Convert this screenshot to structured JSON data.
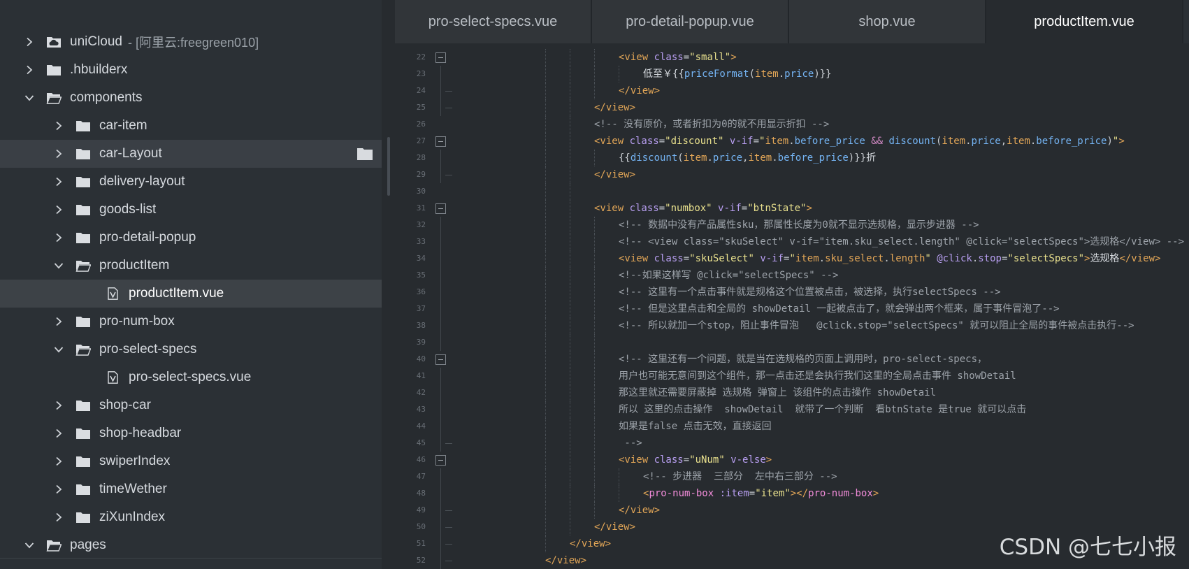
{
  "sidebar": {
    "items": [
      {
        "label": "uniCloud",
        "suffix": "- [阿里云:freegreen010]",
        "icon": "cloud-folder-icon",
        "expanded": false,
        "depth": 0
      },
      {
        "label": ".hbuilderx",
        "icon": "folder-icon",
        "expanded": false,
        "depth": 0
      },
      {
        "label": "components",
        "icon": "folder-open-icon",
        "expanded": true,
        "depth": 0
      },
      {
        "label": "car-item",
        "icon": "folder-icon",
        "expanded": false,
        "depth": 1
      },
      {
        "label": "car-Layout",
        "icon": "folder-icon",
        "expanded": false,
        "depth": 1,
        "hover": true
      },
      {
        "label": "delivery-layout",
        "icon": "folder-icon",
        "expanded": false,
        "depth": 1
      },
      {
        "label": "goods-list",
        "icon": "folder-icon",
        "expanded": false,
        "depth": 1
      },
      {
        "label": "pro-detail-popup",
        "icon": "folder-icon",
        "expanded": false,
        "depth": 1
      },
      {
        "label": "productItem",
        "icon": "folder-open-icon",
        "expanded": true,
        "depth": 1
      },
      {
        "label": "productItem.vue",
        "icon": "vue-file-icon",
        "depth": 2,
        "selected": true
      },
      {
        "label": "pro-num-box",
        "icon": "folder-icon",
        "expanded": false,
        "depth": 1
      },
      {
        "label": "pro-select-specs",
        "icon": "folder-open-icon",
        "expanded": true,
        "depth": 1
      },
      {
        "label": "pro-select-specs.vue",
        "icon": "vue-file-icon",
        "depth": 2
      },
      {
        "label": "shop-car",
        "icon": "folder-icon",
        "expanded": false,
        "depth": 1
      },
      {
        "label": "shop-headbar",
        "icon": "folder-icon",
        "expanded": false,
        "depth": 1
      },
      {
        "label": "swiperIndex",
        "icon": "folder-icon",
        "expanded": false,
        "depth": 1
      },
      {
        "label": "timeWether",
        "icon": "folder-icon",
        "expanded": false,
        "depth": 1
      },
      {
        "label": "ziXunIndex",
        "icon": "folder-icon",
        "expanded": false,
        "depth": 1
      },
      {
        "label": "pages",
        "icon": "folder-open-icon",
        "expanded": true,
        "depth": 0
      }
    ]
  },
  "tabs": [
    {
      "label": "pro-select-specs.vue",
      "active": false
    },
    {
      "label": "pro-detail-popup.vue",
      "active": false
    },
    {
      "label": "shop.vue",
      "active": false
    },
    {
      "label": "productItem.vue",
      "active": true
    }
  ],
  "code": {
    "lines": [
      {
        "n": "22",
        "indent": 6,
        "fold": "box",
        "tokens": [
          [
            "t-tag",
            "<view "
          ],
          [
            "t-attr",
            "class"
          ],
          [
            "t-punc",
            "="
          ],
          [
            "t-str",
            "\"small\""
          ],
          [
            "t-tag",
            ">"
          ]
        ]
      },
      {
        "n": "23",
        "indent": 7,
        "fold": "line",
        "tokens": [
          [
            "t-text",
            "低至￥{{"
          ],
          [
            "t-fn",
            "priceFormat"
          ],
          [
            "t-punc",
            "("
          ],
          [
            "t-prop",
            "item"
          ],
          [
            "t-punc",
            "."
          ],
          [
            "t-fn",
            "price"
          ],
          [
            "t-punc",
            ")}}"
          ]
        ]
      },
      {
        "n": "24",
        "indent": 6,
        "fold": "dash",
        "tokens": [
          [
            "t-tag",
            "</view>"
          ]
        ]
      },
      {
        "n": "25",
        "indent": 5,
        "fold": "dash",
        "tokens": [
          [
            "t-tag",
            "</view>"
          ]
        ]
      },
      {
        "n": "26",
        "indent": 5,
        "fold": "none",
        "tokens": [
          [
            "t-cmt",
            "<!-- 没有原价，或者折扣为0的就不用显示折扣 -->"
          ]
        ]
      },
      {
        "n": "27",
        "indent": 5,
        "fold": "box",
        "tokens": [
          [
            "t-tag",
            "<view "
          ],
          [
            "t-attr",
            "class"
          ],
          [
            "t-punc",
            "="
          ],
          [
            "t-str",
            "\"discount\" "
          ],
          [
            "t-attr",
            "v-if"
          ],
          [
            "t-punc",
            "="
          ],
          [
            "t-str",
            "\""
          ],
          [
            "t-prop",
            "item"
          ],
          [
            "t-punc",
            "."
          ],
          [
            "t-fn",
            "before_price"
          ],
          [
            "t-op",
            " && "
          ],
          [
            "t-fn",
            "discount"
          ],
          [
            "t-punc",
            "("
          ],
          [
            "t-prop",
            "item"
          ],
          [
            "t-punc",
            "."
          ],
          [
            "t-fn",
            "price"
          ],
          [
            "t-punc",
            ","
          ],
          [
            "t-prop",
            "item"
          ],
          [
            "t-punc",
            "."
          ],
          [
            "t-fn",
            "before_price"
          ],
          [
            "t-punc",
            ")"
          ],
          [
            "t-str",
            "\""
          ],
          [
            "t-tag",
            ">"
          ]
        ]
      },
      {
        "n": "28",
        "indent": 6,
        "fold": "line",
        "tokens": [
          [
            "t-punc",
            "{{"
          ],
          [
            "t-fn",
            "discount"
          ],
          [
            "t-punc",
            "("
          ],
          [
            "t-prop",
            "item"
          ],
          [
            "t-punc",
            "."
          ],
          [
            "t-fn",
            "price"
          ],
          [
            "t-punc",
            ","
          ],
          [
            "t-prop",
            "item"
          ],
          [
            "t-punc",
            "."
          ],
          [
            "t-fn",
            "before_price"
          ],
          [
            "t-punc",
            ")}}"
          ],
          [
            "t-text",
            "折"
          ]
        ]
      },
      {
        "n": "29",
        "indent": 5,
        "fold": "dash",
        "tokens": [
          [
            "t-tag",
            "</view>"
          ]
        ]
      },
      {
        "n": "30",
        "indent": 5,
        "fold": "none",
        "tokens": []
      },
      {
        "n": "31",
        "indent": 5,
        "fold": "box",
        "tokens": [
          [
            "t-tag",
            "<view "
          ],
          [
            "t-attr",
            "class"
          ],
          [
            "t-punc",
            "="
          ],
          [
            "t-str",
            "\"numbox\" "
          ],
          [
            "t-attr",
            "v-if"
          ],
          [
            "t-punc",
            "="
          ],
          [
            "t-str",
            "\"btnState\""
          ],
          [
            "t-tag",
            ">"
          ]
        ]
      },
      {
        "n": "32",
        "indent": 6,
        "fold": "line",
        "tokens": [
          [
            "t-cmt",
            "<!-- 数据中没有产品属性sku，那属性长度为0就不显示选规格，显示步进器 -->"
          ]
        ]
      },
      {
        "n": "33",
        "indent": 6,
        "fold": "line",
        "tokens": [
          [
            "t-cmt",
            "<!-- <view class=\"skuSelect\" v-if=\"item.sku_select.length\" @click=\"selectSpecs\">选规格</view> -->"
          ]
        ]
      },
      {
        "n": "34",
        "indent": 6,
        "fold": "line",
        "tokens": [
          [
            "t-tag",
            "<view "
          ],
          [
            "t-attr",
            "class"
          ],
          [
            "t-punc",
            "="
          ],
          [
            "t-str",
            "\"skuSelect\" "
          ],
          [
            "t-attr",
            "v-if"
          ],
          [
            "t-punc",
            "="
          ],
          [
            "t-str",
            "\""
          ],
          [
            "t-prop",
            "item"
          ],
          [
            "t-punc",
            "."
          ],
          [
            "t-prop",
            "sku_select"
          ],
          [
            "t-punc",
            "."
          ],
          [
            "t-prop",
            "length"
          ],
          [
            "t-str",
            "\" "
          ],
          [
            "t-attr",
            "@click"
          ],
          [
            "t-punc",
            "."
          ],
          [
            "t-attr",
            "stop"
          ],
          [
            "t-punc",
            "="
          ],
          [
            "t-str",
            "\"selectSpecs\""
          ],
          [
            "t-tag",
            ">"
          ],
          [
            "t-text",
            "选规格"
          ],
          [
            "t-tag",
            "</view>"
          ]
        ]
      },
      {
        "n": "35",
        "indent": 6,
        "fold": "line",
        "tokens": [
          [
            "t-cmt",
            "<!--如果这样写 @click=\"selectSpecs\" -->"
          ]
        ]
      },
      {
        "n": "36",
        "indent": 6,
        "fold": "line",
        "tokens": [
          [
            "t-cmt",
            "<!-- 这里有一个点击事件就是规格这个位置被点击，被选择，执行selectSpecs -->"
          ]
        ]
      },
      {
        "n": "37",
        "indent": 6,
        "fold": "line",
        "tokens": [
          [
            "t-cmt",
            "<!-- 但是这里点击和全局的 showDetail 一起被点击了，就会弹出两个框来，属于事件冒泡了-->"
          ]
        ]
      },
      {
        "n": "38",
        "indent": 6,
        "fold": "line",
        "tokens": [
          [
            "t-cmt",
            "<!-- 所以就加一个stop，阻止事件冒泡   @click.stop=\"selectSpecs\" 就可以阻止全局的事件被点击执行-->"
          ]
        ]
      },
      {
        "n": "39",
        "indent": 6,
        "fold": "line",
        "tokens": []
      },
      {
        "n": "40",
        "indent": 6,
        "fold": "box",
        "tokens": [
          [
            "t-cmt",
            "<!-- 这里还有一个问题，就是当在选规格的页面上调用时，pro-select-specs，"
          ]
        ]
      },
      {
        "n": "41",
        "indent": 6,
        "fold": "line",
        "tokens": [
          [
            "t-cmt",
            "用户也可能无意间到这个组件，那一点击还是会执行我们这里的全局点击事件 showDetail"
          ]
        ]
      },
      {
        "n": "42",
        "indent": 6,
        "fold": "line",
        "tokens": [
          [
            "t-cmt",
            "那这里就还需要屏蔽掉 选规格 弹窗上 该组件的点击操作 showDetail"
          ]
        ]
      },
      {
        "n": "43",
        "indent": 6,
        "fold": "line",
        "tokens": [
          [
            "t-cmt",
            "所以 这里的点击操作  showDetail  就带了一个判断  看btnState 是true 就可以点击"
          ]
        ]
      },
      {
        "n": "44",
        "indent": 6,
        "fold": "line",
        "tokens": [
          [
            "t-cmt",
            "如果是false 点击无效，直接返回"
          ]
        ]
      },
      {
        "n": "45",
        "indent": 6,
        "fold": "dash",
        "tokens": [
          [
            "t-cmt",
            " -->"
          ]
        ]
      },
      {
        "n": "46",
        "indent": 6,
        "fold": "box",
        "tokens": [
          [
            "t-tag",
            "<view "
          ],
          [
            "t-attr",
            "class"
          ],
          [
            "t-punc",
            "="
          ],
          [
            "t-str",
            "\"uNum\" "
          ],
          [
            "t-attr",
            "v-else"
          ],
          [
            "t-tag",
            ">"
          ]
        ]
      },
      {
        "n": "47",
        "indent": 7,
        "fold": "line",
        "tokens": [
          [
            "t-cmt",
            "<!-- 步进器  三部分  左中右三部分 -->"
          ]
        ]
      },
      {
        "n": "48",
        "indent": 7,
        "fold": "line",
        "tokens": [
          [
            "t-tag",
            "<"
          ],
          [
            "t-comp",
            "pro-num-box "
          ],
          [
            "t-attr",
            ":item"
          ],
          [
            "t-punc",
            "="
          ],
          [
            "t-str",
            "\"item\""
          ],
          [
            "t-tag",
            "></"
          ],
          [
            "t-comp",
            "pro-num-box"
          ],
          [
            "t-tag",
            ">"
          ]
        ]
      },
      {
        "n": "49",
        "indent": 6,
        "fold": "dash",
        "tokens": [
          [
            "t-tag",
            "</view>"
          ]
        ]
      },
      {
        "n": "50",
        "indent": 5,
        "fold": "dash",
        "tokens": [
          [
            "t-tag",
            "</view>"
          ]
        ]
      },
      {
        "n": "51",
        "indent": 4,
        "fold": "dash",
        "tokens": [
          [
            "t-tag",
            "</view>"
          ]
        ]
      },
      {
        "n": "52",
        "indent": 3,
        "fold": "dash",
        "tokens": [
          [
            "t-tag",
            "</view>"
          ]
        ]
      }
    ]
  },
  "watermark": "CSDN @七七小报",
  "colors": {
    "sidebar_bg": "#2b3035",
    "editor_bg": "#272b2f",
    "tag": "#e2a657",
    "attr": "#b79ef0",
    "string": "#e8e08d",
    "comment": "#9ea4ab",
    "function": "#74b3f2"
  }
}
